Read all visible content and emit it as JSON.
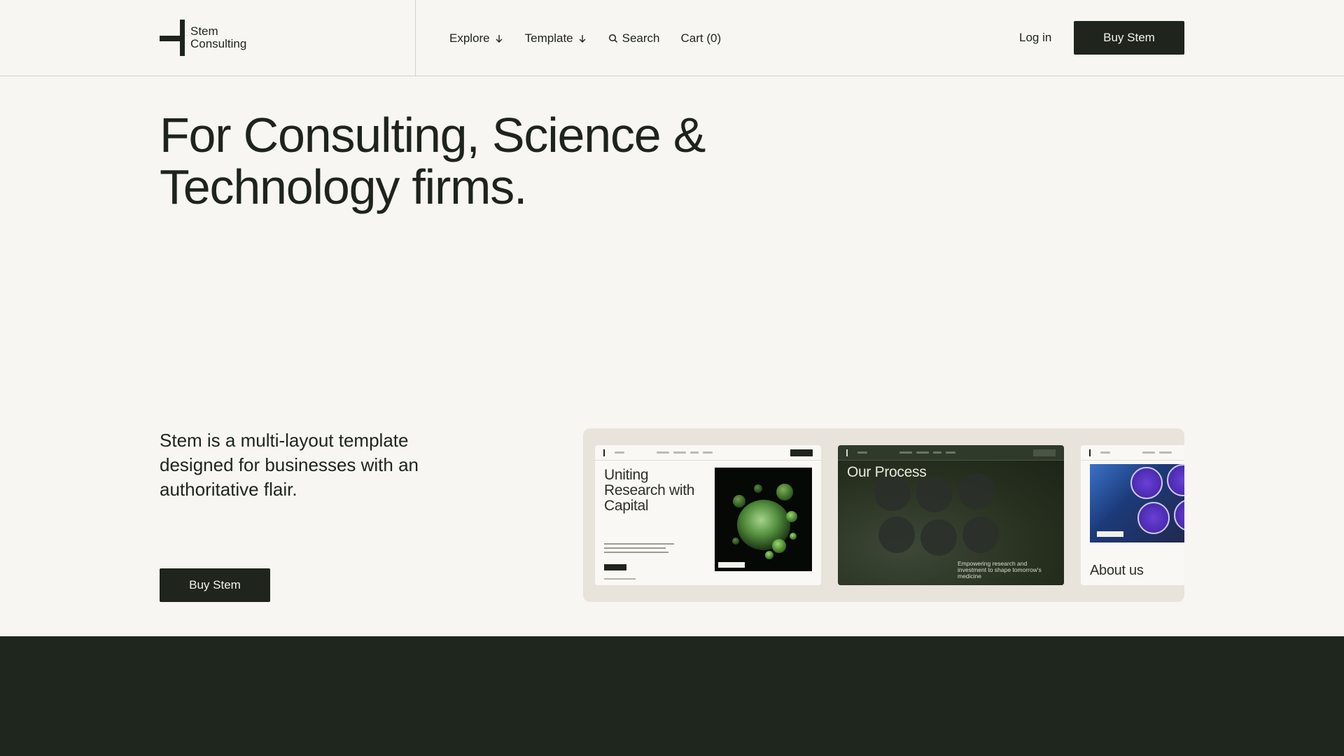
{
  "brand": {
    "name_line1": "Stem",
    "name_line2": "Consulting"
  },
  "nav": {
    "explore": "Explore",
    "template": "Template",
    "search": "Search",
    "cart": "Cart (0)"
  },
  "header": {
    "login": "Log in",
    "buy": "Buy Stem"
  },
  "hero": {
    "headline": "For Consulting, Science & Technology firms.",
    "description": "Stem is a multi-layout template designed for businesses with an authoritative flair.",
    "buy": "Buy Stem"
  },
  "previews": [
    {
      "title": "Uniting Research with Capital"
    },
    {
      "title": "Our Process",
      "subtitle": "Empowering research and investment to shape tomorrow's medicine"
    },
    {
      "title": "About us"
    }
  ],
  "colors": {
    "accent_dark": "#1f241d",
    "background": "#f7f6f2",
    "footer_band": "#1f261d"
  }
}
